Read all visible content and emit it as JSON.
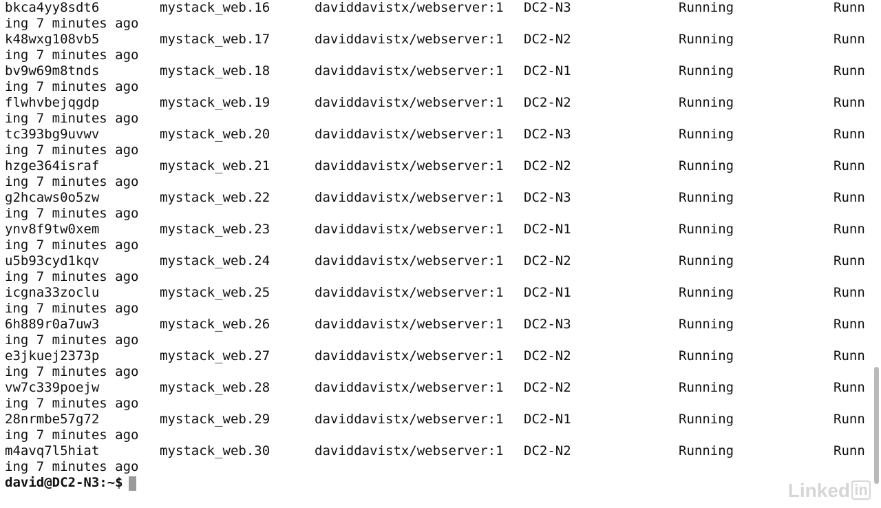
{
  "tasks": [
    {
      "id": "bkca4yy8sdt6",
      "name": "mystack_web.16",
      "image": "daviddavistx/webserver:1",
      "node": "DC2-N3",
      "desired_state": "Running",
      "current_state_head": "Runn",
      "current_state_tail": "ing 7 minutes ago"
    },
    {
      "id": "k48wxg108vb5",
      "name": "mystack_web.17",
      "image": "daviddavistx/webserver:1",
      "node": "DC2-N2",
      "desired_state": "Running",
      "current_state_head": "Runn",
      "current_state_tail": "ing 7 minutes ago"
    },
    {
      "id": "bv9w69m8tnds",
      "name": "mystack_web.18",
      "image": "daviddavistx/webserver:1",
      "node": "DC2-N1",
      "desired_state": "Running",
      "current_state_head": "Runn",
      "current_state_tail": "ing 7 minutes ago"
    },
    {
      "id": "flwhvbejqgdp",
      "name": "mystack_web.19",
      "image": "daviddavistx/webserver:1",
      "node": "DC2-N2",
      "desired_state": "Running",
      "current_state_head": "Runn",
      "current_state_tail": "ing 7 minutes ago"
    },
    {
      "id": "tc393bg9uvwv",
      "name": "mystack_web.20",
      "image": "daviddavistx/webserver:1",
      "node": "DC2-N3",
      "desired_state": "Running",
      "current_state_head": "Runn",
      "current_state_tail": "ing 7 minutes ago"
    },
    {
      "id": "hzge364israf",
      "name": "mystack_web.21",
      "image": "daviddavistx/webserver:1",
      "node": "DC2-N2",
      "desired_state": "Running",
      "current_state_head": "Runn",
      "current_state_tail": "ing 7 minutes ago"
    },
    {
      "id": "g2hcaws0o5zw",
      "name": "mystack_web.22",
      "image": "daviddavistx/webserver:1",
      "node": "DC2-N3",
      "desired_state": "Running",
      "current_state_head": "Runn",
      "current_state_tail": "ing 7 minutes ago"
    },
    {
      "id": "ynv8f9tw0xem",
      "name": "mystack_web.23",
      "image": "daviddavistx/webserver:1",
      "node": "DC2-N1",
      "desired_state": "Running",
      "current_state_head": "Runn",
      "current_state_tail": "ing 7 minutes ago"
    },
    {
      "id": "u5b93cyd1kqv",
      "name": "mystack_web.24",
      "image": "daviddavistx/webserver:1",
      "node": "DC2-N2",
      "desired_state": "Running",
      "current_state_head": "Runn",
      "current_state_tail": "ing 7 minutes ago"
    },
    {
      "id": "icgna33zoclu",
      "name": "mystack_web.25",
      "image": "daviddavistx/webserver:1",
      "node": "DC2-N1",
      "desired_state": "Running",
      "current_state_head": "Runn",
      "current_state_tail": "ing 7 minutes ago"
    },
    {
      "id": "6h889r0a7uw3",
      "name": "mystack_web.26",
      "image": "daviddavistx/webserver:1",
      "node": "DC2-N3",
      "desired_state": "Running",
      "current_state_head": "Runn",
      "current_state_tail": "ing 7 minutes ago"
    },
    {
      "id": "e3jkuej2373p",
      "name": "mystack_web.27",
      "image": "daviddavistx/webserver:1",
      "node": "DC2-N2",
      "desired_state": "Running",
      "current_state_head": "Runn",
      "current_state_tail": "ing 7 minutes ago"
    },
    {
      "id": "vw7c339poejw",
      "name": "mystack_web.28",
      "image": "daviddavistx/webserver:1",
      "node": "DC2-N2",
      "desired_state": "Running",
      "current_state_head": "Runn",
      "current_state_tail": "ing 7 minutes ago"
    },
    {
      "id": "28nrmbe57g72",
      "name": "mystack_web.29",
      "image": "daviddavistx/webserver:1",
      "node": "DC2-N1",
      "desired_state": "Running",
      "current_state_head": "Runn",
      "current_state_tail": "ing 7 minutes ago"
    },
    {
      "id": "m4avq7l5hiat",
      "name": "mystack_web.30",
      "image": "daviddavistx/webserver:1",
      "node": "DC2-N2",
      "desired_state": "Running",
      "current_state_head": "Runn",
      "current_state_tail": "ing 7 minutes ago"
    }
  ],
  "prompt": {
    "text": "david@DC2-N3:~$"
  },
  "watermark": {
    "text": "Linked",
    "box_text": "in"
  },
  "colors": {
    "background": "#ffffff",
    "foreground": "#111111",
    "cursor": "#9a9a9a",
    "scrollbar_thumb": "#b9b9b9"
  }
}
